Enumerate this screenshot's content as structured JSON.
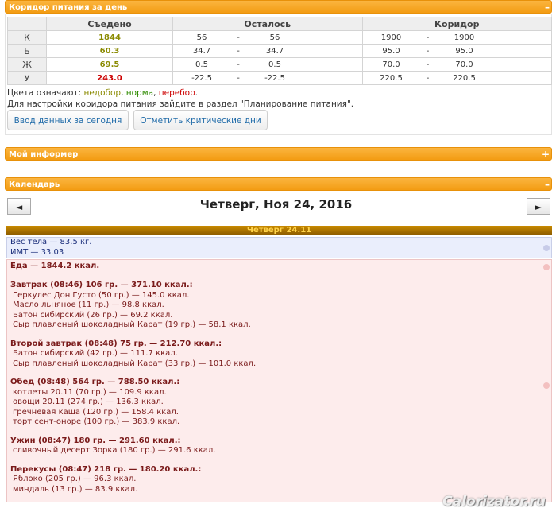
{
  "corridor": {
    "title": "Коридор питания за день",
    "toggle": "–",
    "columns": {
      "eaten": "Съедено",
      "left": "Осталось",
      "corridor": "Коридор"
    },
    "rows": [
      {
        "label": "К",
        "eaten": "1844",
        "status": "under",
        "left_min": "56",
        "left_max": "56",
        "c_min": "1900",
        "c_max": "1900"
      },
      {
        "label": "Б",
        "eaten": "60.3",
        "status": "under",
        "left_min": "34.7",
        "left_max": "34.7",
        "c_min": "95.0",
        "c_max": "95.0"
      },
      {
        "label": "Ж",
        "eaten": "69.5",
        "status": "under",
        "left_min": "0.5",
        "left_max": "0.5",
        "c_min": "70.0",
        "c_max": "70.0"
      },
      {
        "label": "У",
        "eaten": "243.0",
        "status": "over",
        "left_min": "-22.5",
        "left_max": "-22.5",
        "c_min": "220.5",
        "c_max": "220.5"
      }
    ],
    "dash": "-",
    "legend_prefix": "Цвета означают:",
    "legend_under": "недобор",
    "legend_norm": "норма",
    "legend_over": "перебор",
    "note": "Для настройки коридора питания зайдите в раздел \"Планирование питания\".",
    "btn_enter": "Ввод данных за сегодня",
    "btn_critical": "Отметить критические дни",
    "colors": {
      "under": "#8a8a00",
      "norm": "#2e8b00",
      "over": "#cc0000"
    }
  },
  "informer": {
    "title": "Мой информер",
    "toggle": "+"
  },
  "calendar": {
    "title": "Календарь",
    "toggle": "–",
    "date": "Четверг, Ноя 24, 2016",
    "prev": "◄",
    "next": "►",
    "day_label": "Четверг 24.11",
    "weight": "Вес тела — 83.5 кг.",
    "bmi": "ИМТ — 33.03",
    "food_total": "Еда — 1844.2 ккал.",
    "meals": [
      {
        "header": "Завтрак (08:46) 106 гр. — 371.10 ккал.:",
        "items": [
          "Геркулес Дон Густо (50 гр.) — 145.0 ккал.",
          "Масло льняное (11 гр.) — 98.8 ккал.",
          "Батон сибирский (26 гр.) — 69.2 ккал.",
          "Сыр плавленый шоколадный Карат (19 гр.) — 58.1 ккал."
        ]
      },
      {
        "header": "Второй завтрак (08:48) 75 гр. — 212.70 ккал.:",
        "items": [
          "Батон сибирский (42 гр.) — 111.7 ккал.",
          "Сыр плавленый шоколадный Карат (33 гр.) — 101.0 ккал."
        ]
      },
      {
        "header": "Обед (08:48) 564 гр. — 788.50 ккал.:",
        "items": [
          "котлеты 20.11 (70 гр.) — 109.9 ккал.",
          "овощи 20.11 (274 гр.) — 136.3 ккал.",
          "гречневая каша (120 гр.) — 158.4 ккал.",
          "торт сент-оноре (100 гр.) — 383.9 ккал."
        ]
      },
      {
        "header": "Ужин (08:47) 180 гр. — 291.60 ккал.:",
        "items": [
          "сливочный десерт Зорка (180 гр.) — 291.6 ккал."
        ]
      },
      {
        "header": "Перекусы (08:47) 218 гр. — 180.20 ккал.:",
        "items": [
          "Яблоко (205 гр.) — 96.3 ккал.",
          "миндаль (13 гр.) — 83.9 ккал."
        ]
      }
    ]
  },
  "watermark": "Calorizator.ru"
}
